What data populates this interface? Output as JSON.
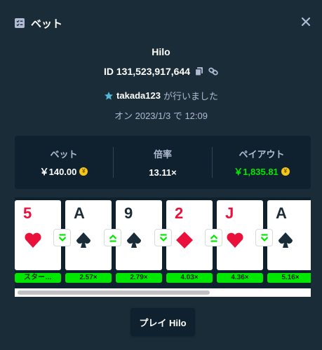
{
  "header": {
    "title": "ベット",
    "icon": "bet-slip-icon",
    "close_icon": "close-icon"
  },
  "game": {
    "name": "Hilo",
    "bet_id": "ID 131,523,917,644",
    "user": "takada123",
    "user_suffix": "が行いました",
    "date": "オン 2023/1/3 で 12:09"
  },
  "stats": {
    "bet_label": "ベット",
    "bet_value": "￥140.00",
    "multiplier_label": "倍率",
    "multiplier_value": "13.11×",
    "payout_label": "ペイアウト",
    "payout_value": "￥1,835.81",
    "coin_symbol": "¥"
  },
  "cards": [
    {
      "rank": "5",
      "suit": "heart",
      "color": "red",
      "multiplier": "スター…"
    },
    {
      "rank": "A",
      "suit": "spade",
      "color": "black",
      "multiplier": "2.57×"
    },
    {
      "rank": "9",
      "suit": "spade",
      "color": "black",
      "multiplier": "2.79×"
    },
    {
      "rank": "2",
      "suit": "diamond",
      "color": "red",
      "multiplier": "4.03×"
    },
    {
      "rank": "J",
      "suit": "heart",
      "color": "red",
      "multiplier": "4.36×"
    },
    {
      "rank": "A",
      "suit": "spade",
      "color": "black",
      "multiplier": "5.16×"
    }
  ],
  "arrows": [
    "lower",
    "higher",
    "lower",
    "higher",
    "lower"
  ],
  "play_button": "プレイ Hilo",
  "colors": {
    "accent_green": "#00e701",
    "background": "#1a2c38",
    "panel": "#0f212e",
    "red_suit": "#e9113c"
  }
}
